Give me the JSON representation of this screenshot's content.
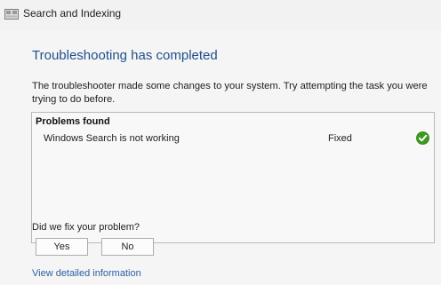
{
  "window": {
    "title": "Search and Indexing",
    "icon": "troubleshooter-icon"
  },
  "main": {
    "heading": "Troubleshooting has completed",
    "description": "The troubleshooter made some changes to your system. Try attempting the task you were trying to do before.",
    "problems": {
      "header": "Problems found",
      "items": [
        {
          "name": "Windows Search is not working",
          "status": "Fixed",
          "status_icon": "green-check-icon"
        }
      ]
    },
    "feedback": {
      "question": "Did we fix your problem?",
      "yes_label": "Yes",
      "no_label": "No"
    },
    "details_link": "View detailed information"
  },
  "colors": {
    "heading": "#1f4f8c",
    "link": "#2b5ea6",
    "fixed_check": "#3e9a1f"
  }
}
